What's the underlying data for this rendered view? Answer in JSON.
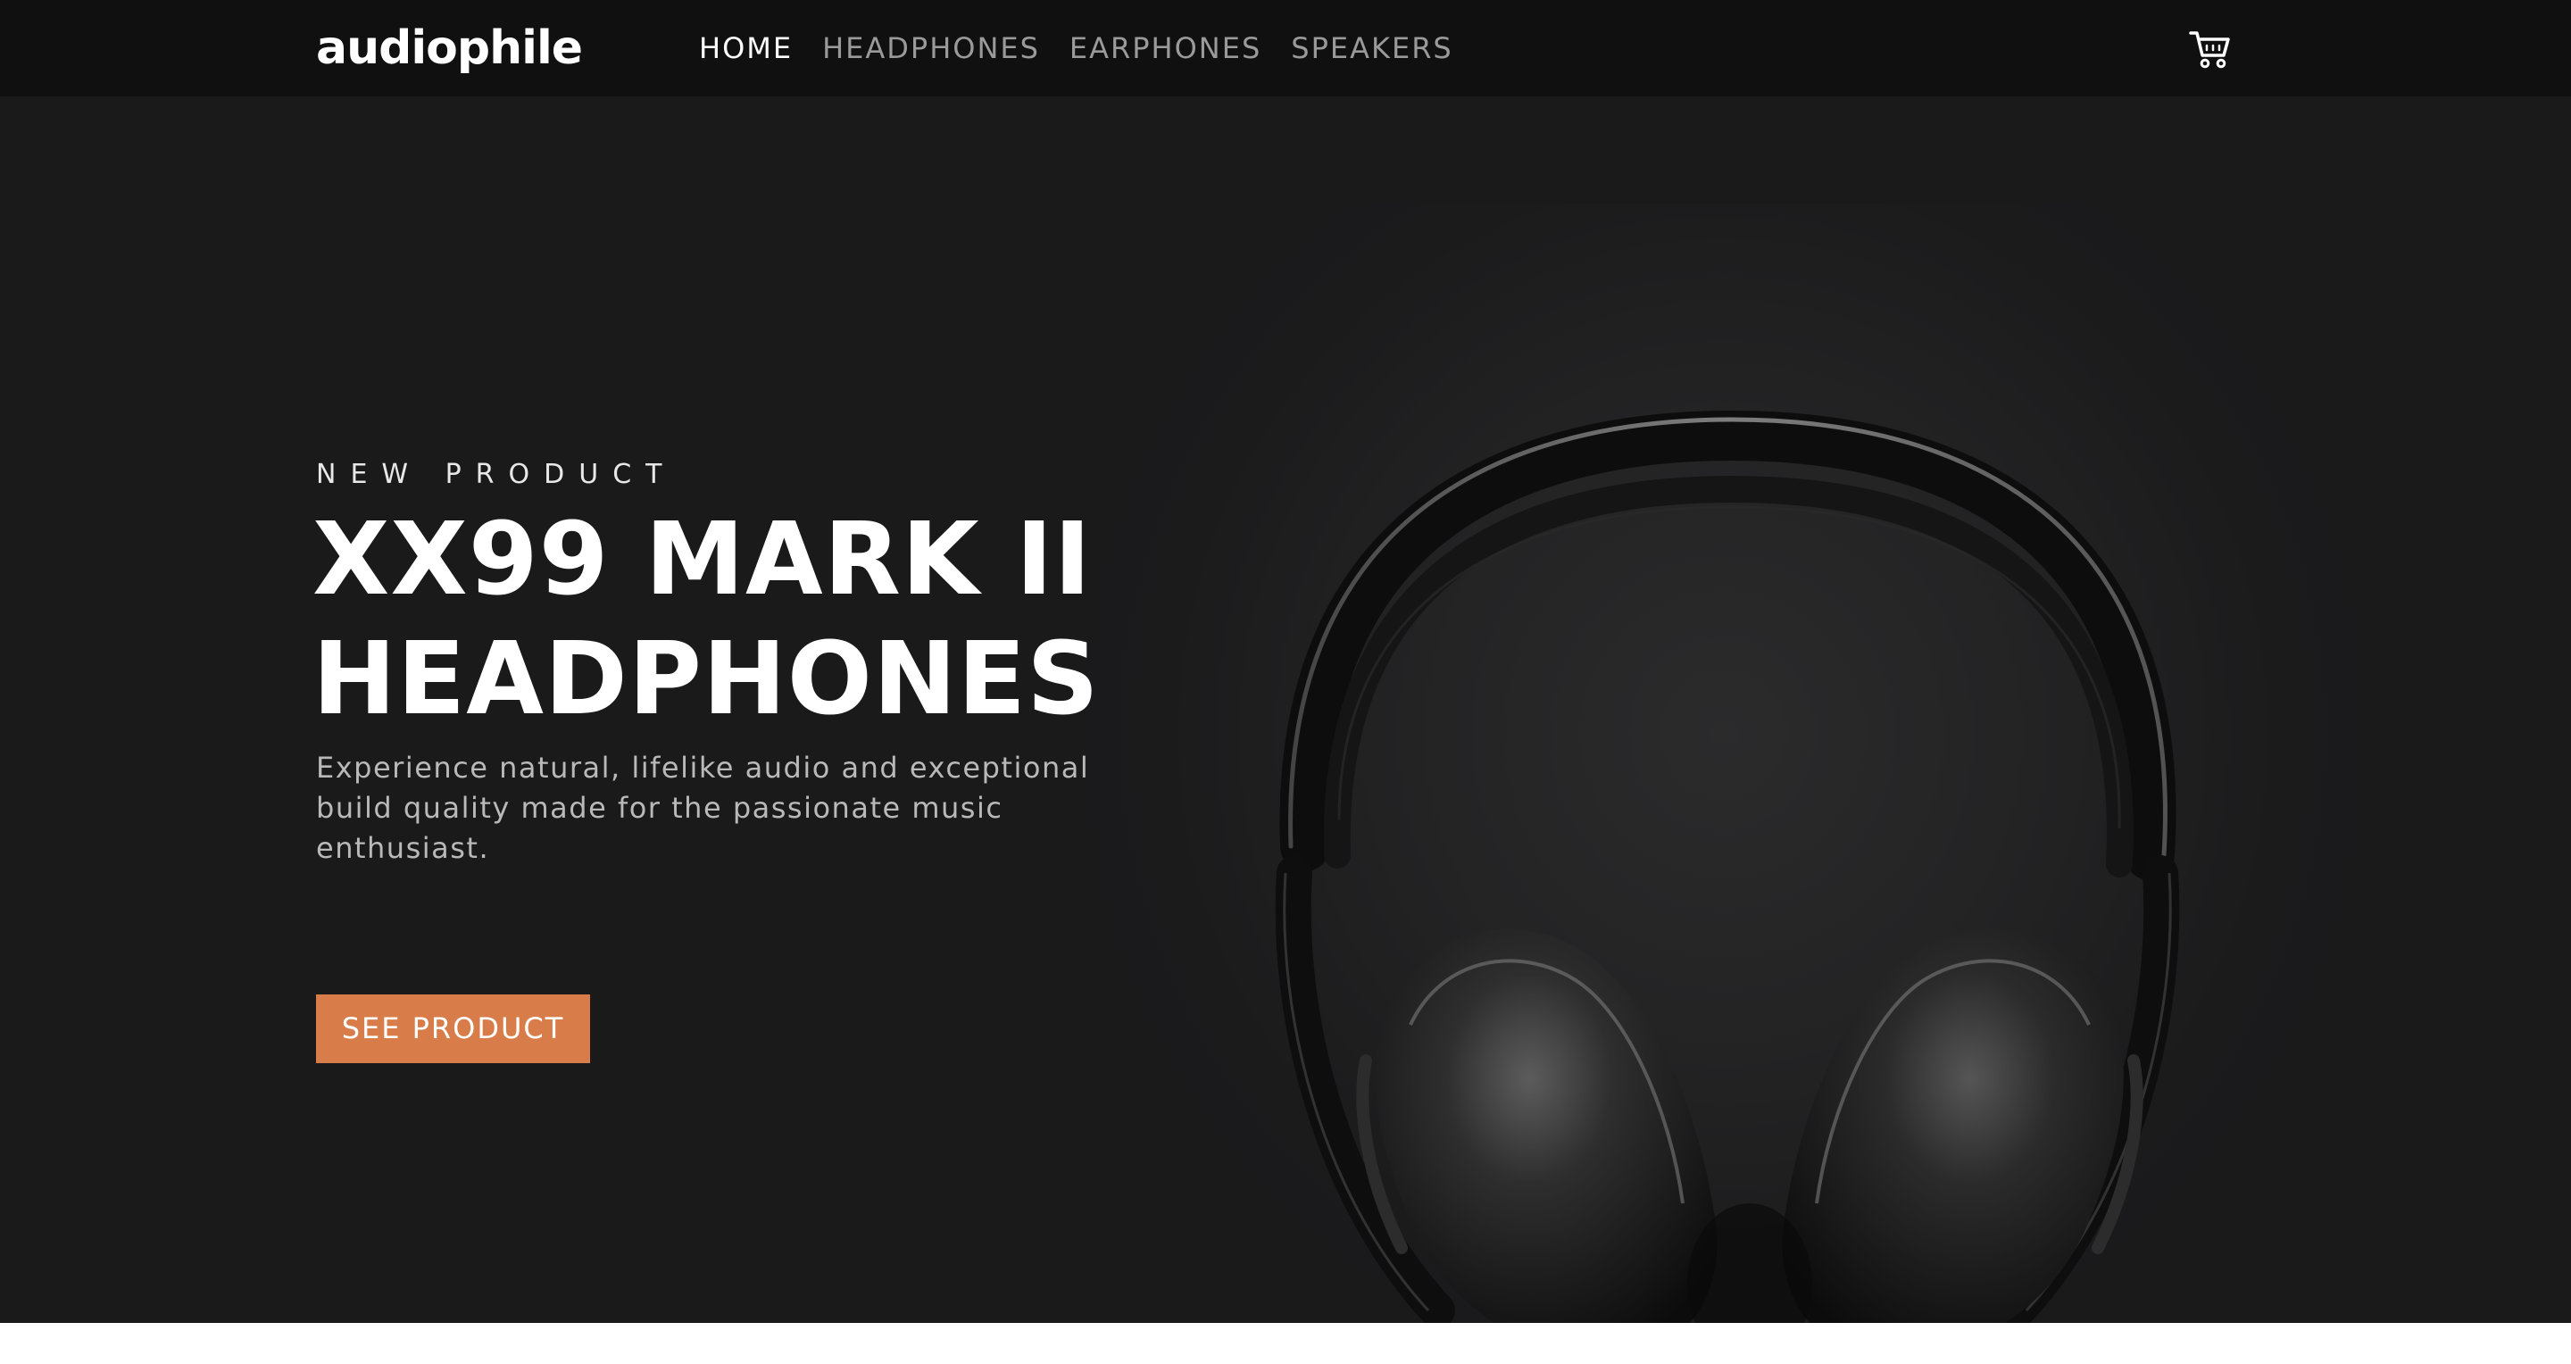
{
  "header": {
    "logo": "audiophile",
    "nav": [
      {
        "label": "HOME",
        "active": true
      },
      {
        "label": "HEADPHONES",
        "active": false
      },
      {
        "label": "EARPHONES",
        "active": false
      },
      {
        "label": "SPEAKERS",
        "active": false
      }
    ],
    "cart_icon": "shopping-cart-icon"
  },
  "hero": {
    "eyebrow": "NEW PRODUCT",
    "title_line1": "XX99 MARK II",
    "title_line2": "HEADPHONES",
    "description": "Experience natural, lifelike audio and exceptional build quality made for the passionate music enthusiast.",
    "cta_label": "SEE PRODUCT",
    "image": "headphones-product-image"
  },
  "colors": {
    "nav_background": "#101010",
    "hero_background": "#1a1a1b",
    "accent": "#d87d4a",
    "text_primary": "#ffffff",
    "text_muted": "#9a9a9a"
  }
}
